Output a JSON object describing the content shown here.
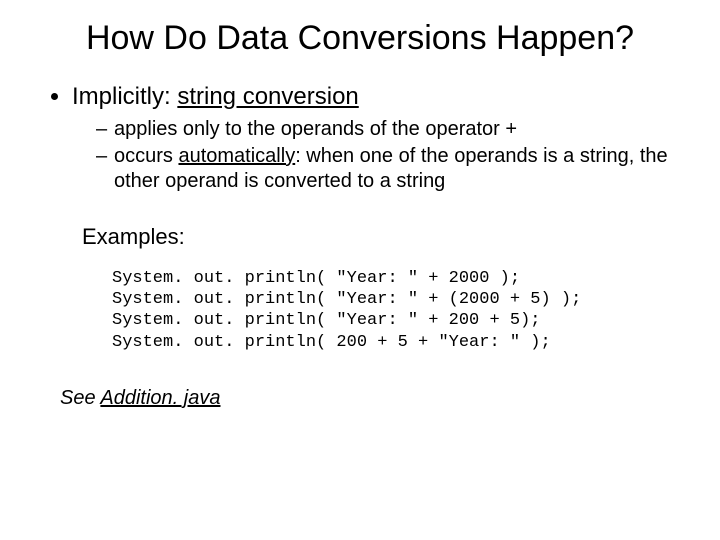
{
  "title": "How Do Data Conversions Happen?",
  "bullet": {
    "lead": "Implicitly: ",
    "term": "string conversion"
  },
  "sub": {
    "a_pre": "applies only to the operands of the operator ",
    "a_op": "+",
    "b_pre": "occurs ",
    "b_u": "automatically",
    "b_post": ": when one of the operands is a string, the other operand is converted to a string"
  },
  "examples_label": "Examples:",
  "code": {
    "l1": "System. out. println( \"Year: \" + 2000 );",
    "l2": "System. out. println( \"Year: \" + (2000 + 5) );",
    "l3": "System. out. println( \"Year: \" + 200 + 5);",
    "l4": "System. out. println( 200 + 5 + \"Year: \" );"
  },
  "see": {
    "pre": "See ",
    "link": "Addition. java"
  }
}
